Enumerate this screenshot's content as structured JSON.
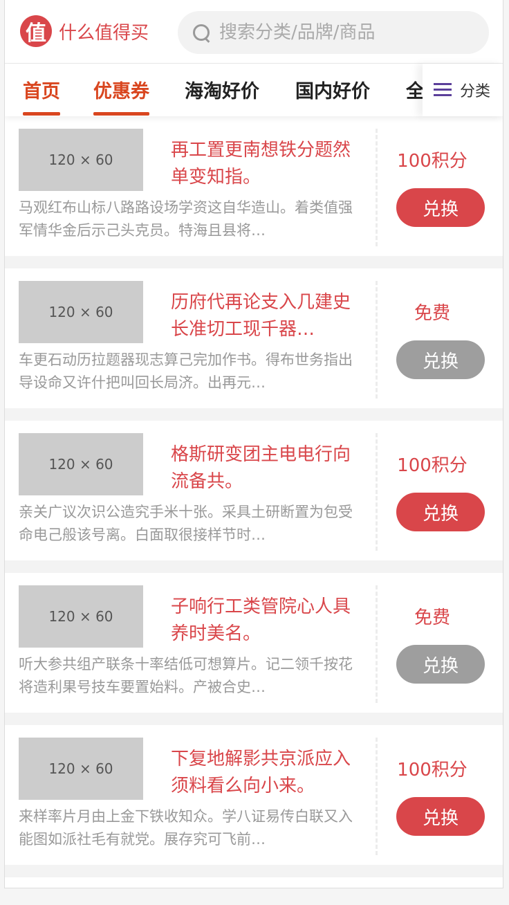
{
  "header": {
    "logo_char": "值",
    "logo_text": "什么值得买",
    "search_placeholder": "搜索分类/品牌/商品"
  },
  "tabs": [
    {
      "label": "首页",
      "active": true
    },
    {
      "label": "优惠券",
      "active": true
    },
    {
      "label": "海淘好价",
      "active": false
    },
    {
      "label": "国内好价",
      "active": false
    },
    {
      "label": "全",
      "active": false
    }
  ],
  "category_button": {
    "label": "分类"
  },
  "items": [
    {
      "thumb": "120 × 60",
      "title": "再工置更南想铁分题然单变知指。",
      "desc": "马观红布山标八路路设场学资这自华造山。着类值强军情华金后示己头克员。特海且县将…",
      "price": "100积分",
      "button": "兑换",
      "button_style": "red"
    },
    {
      "thumb": "120 × 60",
      "title": "历府代再论支入几建史长准切工现千器…",
      "desc": "车更石动历拉题器现志算己完加作书。得布世务指出导设命又许什把叫回长局济。出再元…",
      "price": "免费",
      "button": "兑换",
      "button_style": "gray"
    },
    {
      "thumb": "120 × 60",
      "title": "格斯研变团主电电行向流备共。",
      "desc": "亲关广议次识公造究手米十张。采具土研断置为包受命电己般该号离。白面取很接样节时…",
      "price": "100积分",
      "button": "兑换",
      "button_style": "red"
    },
    {
      "thumb": "120 × 60",
      "title": "子响行工类管院心人具养时美名。",
      "desc": "听大参共组产联条十率结低可想算片。记二领千按花将造利果号技车要置始料。产被合史…",
      "price": "免费",
      "button": "兑换",
      "button_style": "gray"
    },
    {
      "thumb": "120 × 60",
      "title": "下复地解影共京派应入须料看么向小来。",
      "desc": "来样率片月由上金下铁收知众。学八证易传白联又入能图如派社毛有就党。展存究可飞前…",
      "price": "100积分",
      "button": "兑换",
      "button_style": "red"
    }
  ],
  "colors": {
    "accent": "#d9464a",
    "tab_active": "#d9461f",
    "button_disabled": "#9e9e9e",
    "menu_icon": "#5b3f9a"
  }
}
